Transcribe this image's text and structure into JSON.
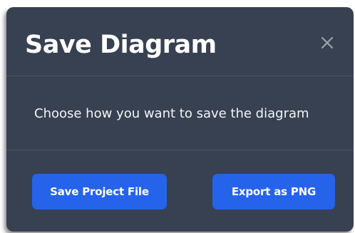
{
  "dialog": {
    "title": "Save Diagram",
    "close_icon": "close-icon",
    "message": "Choose how you want to save the diagram",
    "buttons": {
      "save_project": "Save Project File",
      "export_png": "Export as PNG"
    }
  },
  "colors": {
    "dialog_bg": "#374151",
    "divider": "#4b5563",
    "primary_button": "#2563eb",
    "title_text": "#ffffff",
    "body_text": "#f3f4f6",
    "close_icon": "#9ca3af"
  }
}
